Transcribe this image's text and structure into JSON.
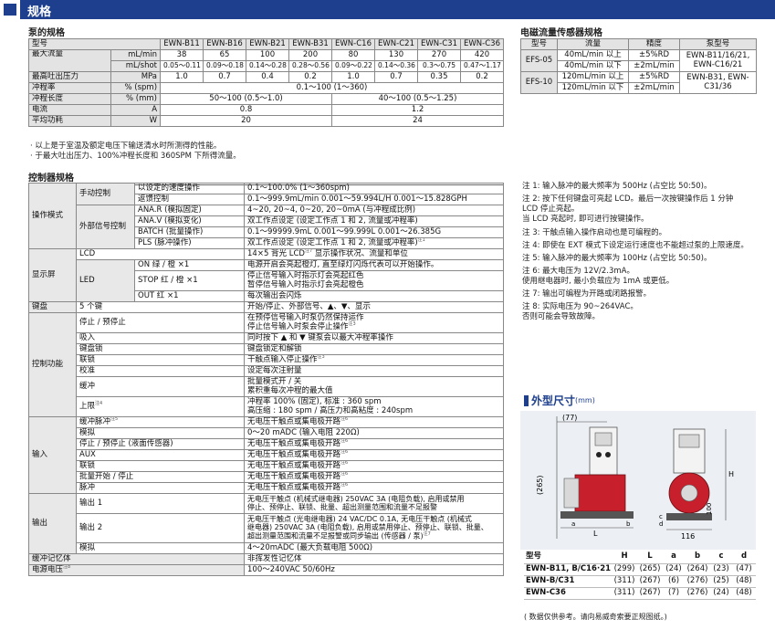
{
  "header": {
    "title": "规格"
  },
  "pump": {
    "heading": "泵的规格",
    "columns": [
      "型号",
      "EWN-B11",
      "EWN-B16",
      "EWN-B21",
      "EWN-B31",
      "EWN-C16",
      "EWN-C21",
      "EWN-C31",
      "EWN-C36"
    ],
    "flow_label": "最大流量",
    "flow_unit_min": "mL/min",
    "flow_values_min": [
      "38",
      "65",
      "100",
      "200",
      "80",
      "130",
      "270",
      "420"
    ],
    "flow_unit_shot": "mL/shot",
    "flow_values_shot": [
      "0.05～0.11",
      "0.09～0.18",
      "0.14～0.28",
      "0.28～0.56",
      "0.09～0.22",
      "0.14～0.36",
      "0.3～0.75",
      "0.47～1.17"
    ],
    "pressure_label": "最高吐出压力",
    "pressure_unit": "MPa",
    "pressure_values": [
      "1.0",
      "0.7",
      "0.4",
      "0.2",
      "1.0",
      "0.7",
      "0.35",
      "0.2"
    ],
    "stroke_rate_label": "冲程率",
    "stroke_rate_unit": "% (spm)",
    "stroke_rate_value": "0.1～100 (1～360)",
    "stroke_len_label": "冲程长度",
    "stroke_len_unit": "% (mm)",
    "stroke_len_b": "50～100 (0.5～1.0)",
    "stroke_len_c": "40～100 (0.5～1.25)",
    "current_label": "电流",
    "current_unit": "A",
    "current_b": "0.8",
    "current_c": "1.2",
    "power_label": "平均功耗",
    "power_unit": "W",
    "power_b": "20",
    "power_c": "24",
    "notes": [
      "· 以上是于室温及额定电压下输送清水时所测得的性能。",
      "· 于最大吐出压力、100%冲程长度和 360SPM 下所得流量。"
    ]
  },
  "sensor": {
    "heading": "电磁流量传感器规格",
    "columns": [
      "型号",
      "流量",
      "精度",
      "泵型号"
    ],
    "rows": [
      {
        "model": "EFS-05",
        "flow1": "40mL/min 以上",
        "acc1": "±5%RD",
        "flow2": "40mL/min 以下",
        "acc2": "±2mL/min",
        "pump": "EWN-B11/16/21, EWN-C16/21"
      },
      {
        "model": "EFS-10",
        "flow1": "120mL/min 以上",
        "acc1": "±5%RD",
        "flow2": "120mL/min 以下",
        "acc2": "±2mL/min",
        "pump": "EWN-B31, EWN-C31/36"
      }
    ]
  },
  "controller": {
    "heading": "控制器规格",
    "op": {
      "cat": "操作模式",
      "manual": "手动控制",
      "manual_rows": [
        {
          "item": "以设定的速度操作",
          "val": "0.1～100.0% (1～360spm)"
        },
        {
          "item": "返馈控制",
          "val": "0.1～999.9mL/min  0.001～59.994L/H  0.001～15.828GPH"
        }
      ],
      "external": "外部信号控制",
      "external_rows": [
        {
          "item": "ANA.R (模拟固定)",
          "val": "4~20, 20~4, 0~20, 20~0mA (与冲程成比例)"
        },
        {
          "item": "ANA.V (模拟变化)",
          "val": "双工作点设定 (设定工作点 1 和 2, 流量或冲程率)"
        },
        {
          "item": "BATCH (批量操作)",
          "val": "0.1～99999.9mL  0.001～99.999L  0.001～26.385G"
        },
        {
          "item": "PLS (脉冲操作)",
          "val": "双工作点设定 (设定工作点 1 和 2, 流量或冲程率)",
          "sup": "注1"
        }
      ]
    },
    "disp": {
      "cat": "显示屏",
      "lcd": "LCD",
      "lcd_val": "14×5 背光 LCD",
      "lcd_sup": "注7",
      "lcd_val2": " 显示操作状况、流量和单位",
      "led": "LED",
      "led_rows": [
        {
          "item": "ON 绿 / 橙 ×1",
          "val": "电源开启会亮起橙灯, 直至绿灯闪烁代表可以开始操作。"
        },
        {
          "item": "STOP 红 / 橙 ×1",
          "val": "停止信号输入时指示灯会亮起红色\n暂停信号输入时指示灯会亮起橙色"
        },
        {
          "item": "OUT 红 ×1",
          "val": "每次输出会闪烁"
        }
      ]
    },
    "keypad": {
      "cat": "键盘",
      "item": "5 个键",
      "val": "开始/停止、外部信号、▲、▼、显示"
    },
    "func": {
      "cat": "控制功能",
      "rows": [
        {
          "item": "停止 / 预停止",
          "val": "在预停信号输入时泵仍然保持运作\n停止信号输入时泵会停止操作",
          "sup": "注3"
        },
        {
          "item": "吸入",
          "val": "同时按下 ▲ 和 ▼ 键泵会以最大冲程率操作"
        },
        {
          "item": "键盘锁",
          "val": "键盘锁定和解锁"
        },
        {
          "item": "联锁",
          "val": "干触点输入停止操作",
          "sup": "注3"
        },
        {
          "item": "校准",
          "val": "设定每次注射量"
        },
        {
          "item": "缓冲",
          "val": "批量模式开 / 关\n累积重每次冲程的最大值"
        },
        {
          "item": "上限",
          "sup_item": "注4",
          "val": "冲程率 100% (固定), 标准 : 360 spm\n高压缩 : 180 spm / 高压力和高粘度 : 240spm"
        }
      ]
    },
    "input": {
      "cat": "输入",
      "rows": [
        {
          "item": "缓冲脉冲",
          "sup_item": "注5",
          "val": "无电压干触点或集电极开路",
          "sup": "注6"
        },
        {
          "item": "模拟",
          "val": "0～20 mADC (输入电阻 220Ω)"
        },
        {
          "item": "停止 / 预停止 (液面传感器)",
          "val": "无电压干触点或集电极开路",
          "sup": "注6"
        },
        {
          "item": "AUX",
          "val": "无电压干触点或集电极开路",
          "sup": "注6"
        },
        {
          "item": "联锁",
          "val": "无电压干触点或集电极开路",
          "sup": "注6"
        },
        {
          "item": "批量开始 / 停止",
          "val": "无电压干触点或集电极开路",
          "sup": "注6"
        },
        {
          "item": "脉冲",
          "val": "无电压干触点或集电极开路",
          "sup": "注6"
        }
      ]
    },
    "output": {
      "cat": "输出",
      "rows": [
        {
          "item": "输出 1",
          "val": "无电压干触点 (机械式继电器) 250VAC 3A (电阻负载), 启用或禁用\n停止、预停止、联锁、批量、超出测量范围和流量不足报警"
        },
        {
          "item": "输出 2",
          "val": "无电压干触点 (光电继电器) 24 VAC/DC 0.1A, 无电压干触点 (机械式\n继电器) 250VAC 3A (电阻负载), 启用或禁用停止、预停止、联锁、批量、\n超出测量范围和流量不足报警或同步输出 (传感器 / 泵)",
          "sup": "注7"
        },
        {
          "item": "模拟",
          "val": "4～20mADC (最大负载电阻 500Ω)"
        }
      ]
    },
    "memory": {
      "cat": "缓冲记忆体",
      "val": "非挥发性记忆体"
    },
    "power": {
      "cat": "电源电压",
      "sup": "注8",
      "val": "100～240VAC 50/60Hz"
    }
  },
  "notes": [
    "注 1: 输入脉冲的最大频率为 500Hz (占空比 50:50)。",
    "注 2: 按下任何键盘可亮起 LCD。最后一次按键操作后 1 分钟",
    "      LCD 停止亮起。",
    "      当 LCD 亮起时, 即可进行按键操作。",
    "注 3: 干触点输入操作启动也是可编程的。",
    "注 4: 即使在 EXT 模式下设定运行速度也不能超过泵的上限速度。",
    "注 5: 输入脉冲的最大频率为 100Hz (占空比 50:50)。",
    "注 6: 最大电压为 12V/2.3mA。",
    "      使用继电器时, 最小负载应为 1mA 或更低。",
    "注 7: 输出可编程为开路或闭路报警。",
    "注 8: 实际电压为 90~264VAC。",
    "      否则可能会导致故障。"
  ],
  "outline": {
    "title": "外型尺寸",
    "unit": "(mm)",
    "dim_labels": {
      "d77": "(77)",
      "d265": "(265)",
      "d116": "116",
      "d100": "100",
      "dl": "L",
      "dh": "H",
      "da": "a",
      "db": "b",
      "dc": "c",
      "dd": "d"
    },
    "columns": [
      "型号",
      "H",
      "L",
      "a",
      "b",
      "c",
      "d"
    ],
    "rows": [
      [
        "EWN-B11, B/C16·21",
        "(299)",
        "(265)",
        "(24)",
        "(264)",
        "(23)",
        "(47)"
      ],
      [
        "EWN-B/C31",
        "(311)",
        "(267)",
        "(6)",
        "(276)",
        "(25)",
        "(48)"
      ],
      [
        "EWN-C36",
        "(311)",
        "(267)",
        "(7)",
        "(276)",
        "(24)",
        "(48)"
      ]
    ],
    "footnote": "( 数据仅供参考。请向易威奇索要正规图纸。)"
  }
}
